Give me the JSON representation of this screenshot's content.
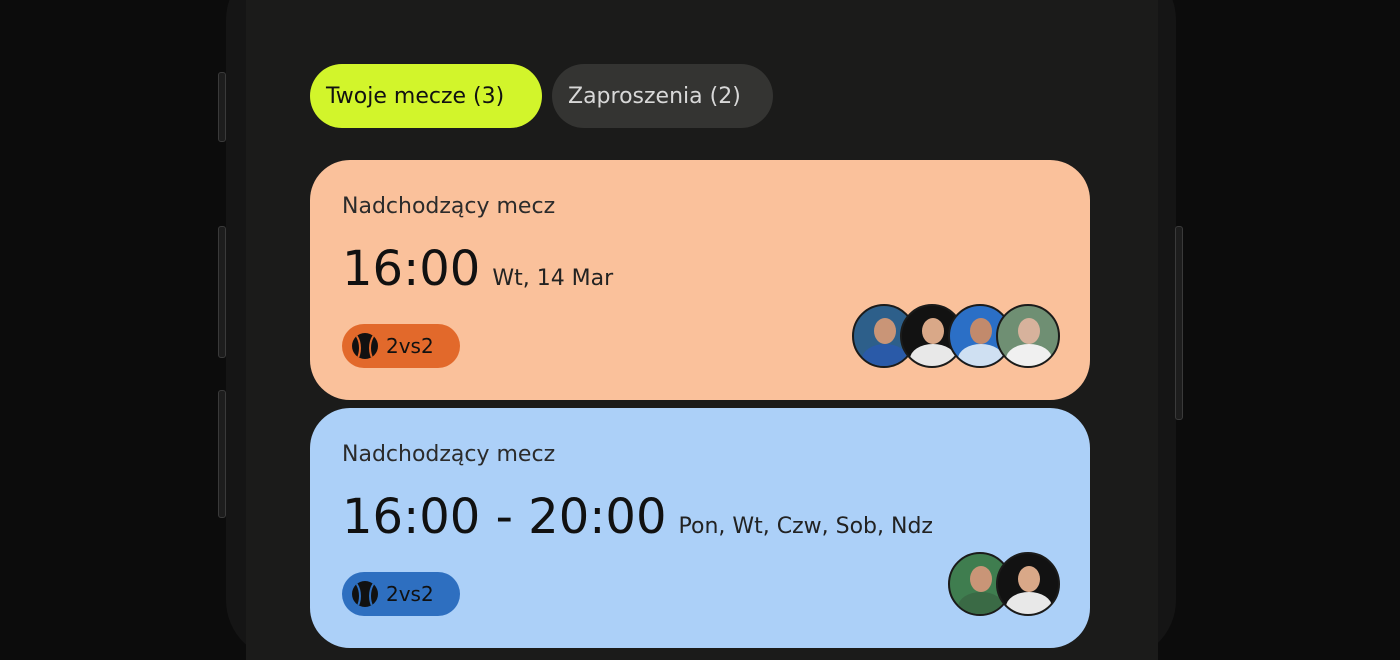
{
  "tabs": [
    {
      "label": "Twoje mecze (3)",
      "active": true
    },
    {
      "label": "Zaproszenia (2)",
      "active": false
    }
  ],
  "matches": [
    {
      "label": "Nadchodzący mecz",
      "time": "16:00",
      "date": "Wt, 14 Mar",
      "badge": "2vs2",
      "color": "#fac19b",
      "badge_color": "#e2692b",
      "avatar_count": 4
    },
    {
      "label": "Nadchodzący mecz",
      "time": "16:00 - 20:00",
      "date": "Pon, Wt, Czw, Sob, Ndz",
      "badge": "2vs2",
      "color": "#acd0f8",
      "badge_color": "#2e6fc0",
      "avatar_count": 2
    }
  ],
  "colors": {
    "accent": "#d2f52b",
    "background": "#1b1b1a"
  }
}
